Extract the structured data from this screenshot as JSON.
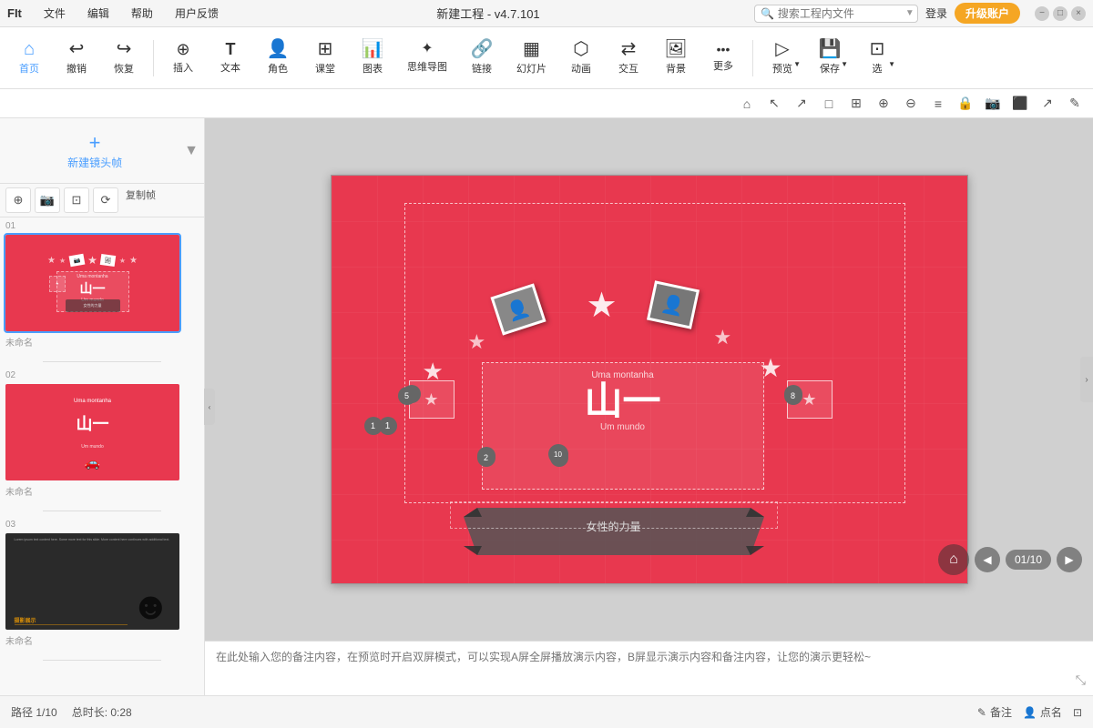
{
  "titlebar": {
    "logo": "FIt",
    "menu": [
      "文件",
      "编辑",
      "帮助",
      "用户反馈"
    ],
    "title": "新建工程 - v4.7.101",
    "search_placeholder": "搜索工程内文件",
    "login": "登录",
    "upgrade": "升级账户",
    "win_minimize": "−",
    "win_maximize": "□",
    "win_close": "×"
  },
  "toolbar": {
    "items": [
      {
        "id": "home",
        "icon": "⌂",
        "label": "首页"
      },
      {
        "id": "undo",
        "icon": "↩",
        "label": "撤销"
      },
      {
        "id": "redo",
        "icon": "↪",
        "label": "恢复"
      },
      {
        "id": "insert",
        "icon": "⊕",
        "label": "插入"
      },
      {
        "id": "text",
        "icon": "T",
        "label": "文本"
      },
      {
        "id": "role",
        "icon": "👤",
        "label": "角色"
      },
      {
        "id": "class",
        "icon": "⊞",
        "label": "课堂"
      },
      {
        "id": "chart",
        "icon": "📊",
        "label": "图表"
      },
      {
        "id": "mindmap",
        "icon": "⊛",
        "label": "思维导图"
      },
      {
        "id": "link",
        "icon": "🔗",
        "label": "链接"
      },
      {
        "id": "ppt",
        "icon": "▦",
        "label": "幻灯片"
      },
      {
        "id": "animation",
        "icon": "⬡",
        "label": "动画"
      },
      {
        "id": "interact",
        "icon": "⇄",
        "label": "交互"
      },
      {
        "id": "bg",
        "icon": "🖼",
        "label": "背景"
      },
      {
        "id": "more",
        "icon": "···",
        "label": "更多"
      },
      {
        "id": "preview",
        "icon": "▷",
        "label": "预览"
      },
      {
        "id": "save",
        "icon": "💾",
        "label": "保存"
      },
      {
        "id": "select",
        "icon": "⊡",
        "label": "选"
      }
    ]
  },
  "second_toolbar": {
    "buttons": [
      "⌂",
      "↗",
      "↙",
      "□□",
      "⊕",
      "⊖",
      "≡",
      "🔒",
      "📷",
      "⬛",
      "↗",
      "✎"
    ]
  },
  "sidebar": {
    "new_frame_label": "新建镜头帧",
    "copy_frame": "复制帧",
    "slides": [
      {
        "num": "01",
        "label": "未命名",
        "active": true,
        "type": "red_stars"
      },
      {
        "num": "02",
        "label": "未命名",
        "active": false,
        "type": "text_slide"
      },
      {
        "num": "03",
        "label": "未命名",
        "active": false,
        "type": "dark_slide"
      }
    ]
  },
  "canvas": {
    "slide": {
      "chinese_text": "山一",
      "subtitle_top": "Uma montanha",
      "subtitle_bottom": "Um mundo",
      "banner_text": "女性的力量",
      "number_badges": [
        "1",
        "2",
        "5",
        "8",
        "10"
      ]
    }
  },
  "notes": {
    "placeholder": "在此处输入您的备注内容，在预览时开启双屏模式，可以实现A屏全屏播放演示内容，B屏显示演示内容和备注内容，让您的演示更轻松~"
  },
  "bottombar": {
    "path": "路径 1/10",
    "duration": "总时长: 0:28",
    "annotation": "备注",
    "callout": "点名",
    "right_icon": "⊡"
  },
  "navigation": {
    "home_icon": "⌂",
    "prev_icon": "◀",
    "counter": "01/10",
    "next_icon": "▶"
  }
}
